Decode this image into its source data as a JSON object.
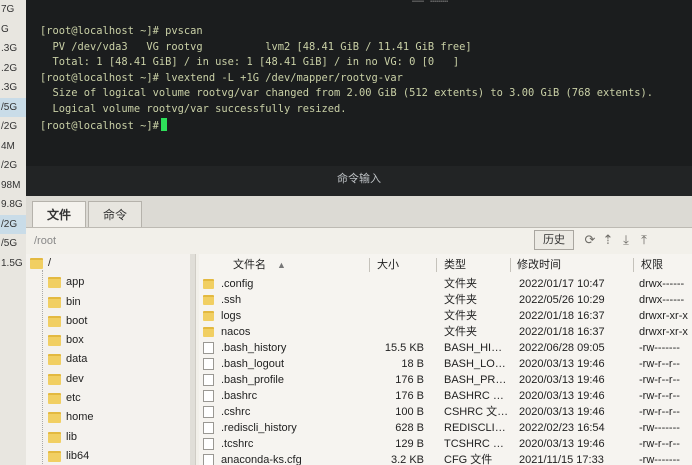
{
  "left_strip": {
    "sizes": [
      "7G",
      "G",
      ".3G",
      ".2G",
      ".3G",
      "/5G",
      "/2G",
      "4M",
      "/2G",
      "98M",
      "9.8G",
      "/2G",
      "/5G",
      "1.5G"
    ]
  },
  "terminal": {
    "top_fragment": "·…… ………",
    "lines": [
      "[root@localhost ~]# pvscan",
      "  PV /dev/vda3   VG rootvg          lvm2 [48.41 GiB / 11.41 GiB free]",
      "  Total: 1 [48.41 GiB] / in use: 1 [48.41 GiB] / in no VG: 0 [0   ]",
      "[root@localhost ~]# lvextend -L +1G /dev/mapper/rootvg-var",
      "  Size of logical volume rootvg/var changed from 2.00 GiB (512 extents) to 3.00 GiB (768 extents).",
      "  Logical volume rootvg/var successfully resized.",
      "[root@localhost ~]#"
    ],
    "cmd_input_label": "命令输入"
  },
  "tabs": [
    {
      "label": "文件",
      "active": true
    },
    {
      "label": "命令",
      "active": false
    }
  ],
  "pathbar": {
    "path": "/root",
    "history_label": "历史",
    "icons": [
      "refresh-icon",
      "upload-icon",
      "download-icon",
      "upload-folder-icon"
    ]
  },
  "tree": {
    "root": "/",
    "items": [
      "app",
      "bin",
      "boot",
      "box",
      "data",
      "dev",
      "etc",
      "home",
      "lib",
      "lib64"
    ]
  },
  "files": {
    "columns": {
      "name": "文件名",
      "size": "大小",
      "type": "类型",
      "modified": "修改时间",
      "perm": "权限"
    },
    "rows": [
      {
        "icon": "folder",
        "name": ".config",
        "size": "",
        "type": "文件夹",
        "modified": "2022/01/17 10:47",
        "perm": "drwx------"
      },
      {
        "icon": "folder",
        "name": ".ssh",
        "size": "",
        "type": "文件夹",
        "modified": "2022/05/26 10:29",
        "perm": "drwx------"
      },
      {
        "icon": "folder",
        "name": "logs",
        "size": "",
        "type": "文件夹",
        "modified": "2022/01/18 16:37",
        "perm": "drwxr-xr-x"
      },
      {
        "icon": "folder",
        "name": "nacos",
        "size": "",
        "type": "文件夹",
        "modified": "2022/01/18 16:37",
        "perm": "drwxr-xr-x"
      },
      {
        "icon": "file",
        "name": ".bash_history",
        "size": "15.5 KB",
        "type": "BASH_HI…",
        "modified": "2022/06/28 09:05",
        "perm": "-rw-------"
      },
      {
        "icon": "file",
        "name": ".bash_logout",
        "size": "18 B",
        "type": "BASH_LO…",
        "modified": "2020/03/13 19:46",
        "perm": "-rw-r--r--"
      },
      {
        "icon": "file",
        "name": ".bash_profile",
        "size": "176 B",
        "type": "BASH_PR…",
        "modified": "2020/03/13 19:46",
        "perm": "-rw-r--r--"
      },
      {
        "icon": "file",
        "name": ".bashrc",
        "size": "176 B",
        "type": "BASHRC …",
        "modified": "2020/03/13 19:46",
        "perm": "-rw-r--r--"
      },
      {
        "icon": "file",
        "name": ".cshrc",
        "size": "100 B",
        "type": "CSHRC 文…",
        "modified": "2020/03/13 19:46",
        "perm": "-rw-r--r--"
      },
      {
        "icon": "file",
        "name": ".rediscli_history",
        "size": "628 B",
        "type": "REDISCLI…",
        "modified": "2022/02/23 16:54",
        "perm": "-rw-------"
      },
      {
        "icon": "file",
        "name": ".tcshrc",
        "size": "129 B",
        "type": "TCSHRC …",
        "modified": "2020/03/13 19:46",
        "perm": "-rw-r--r--"
      },
      {
        "icon": "file",
        "name": "anaconda-ks.cfg",
        "size": "3.2 KB",
        "type": "CFG 文件",
        "modified": "2021/11/15 17:33",
        "perm": "-rw-------"
      }
    ]
  }
}
